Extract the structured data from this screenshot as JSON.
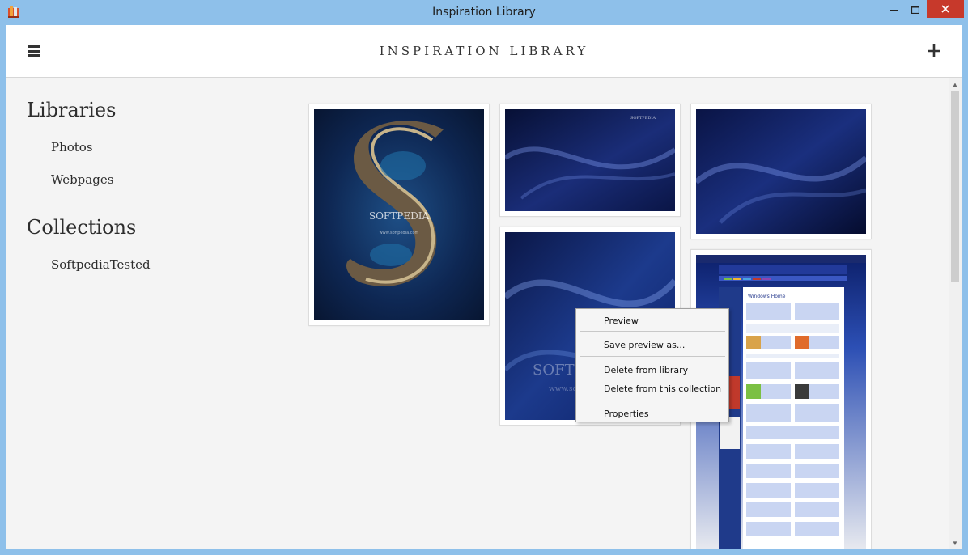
{
  "window": {
    "title": "Inspiration Library",
    "min_glyph": "—",
    "max_glyph": "☐",
    "close_glyph": "✕"
  },
  "header": {
    "app_title": "INSPIRATION LIBRARY",
    "menu_icon": "hamburger-menu-icon",
    "add_icon": "plus-icon"
  },
  "sidebar": {
    "libraries_heading": "Libraries",
    "libraries": [
      {
        "label": "Photos"
      },
      {
        "label": "Webpages"
      }
    ],
    "collections_heading": "Collections",
    "collections": [
      {
        "label": "SoftpediaTested"
      }
    ]
  },
  "images": {
    "island_watermark": "SOFTPEDIA",
    "island_url": "www.softpedia.com",
    "wallpaper_logo": "SOFTPEDIA",
    "wallpaper_url": "www.softpedia.com",
    "webpage_heading": "Windows Home"
  },
  "context_menu": {
    "items": [
      {
        "label": "Preview"
      },
      {
        "label": "Save preview as..."
      },
      {
        "label": "Delete from library"
      },
      {
        "label": "Delete from this collection"
      },
      {
        "label": "Properties"
      }
    ]
  },
  "colors": {
    "titlebar": "#8ec0ea",
    "close_button": "#c7392b",
    "client_bg": "#f4f4f4",
    "wallpaper_dark": "#0b1540"
  }
}
